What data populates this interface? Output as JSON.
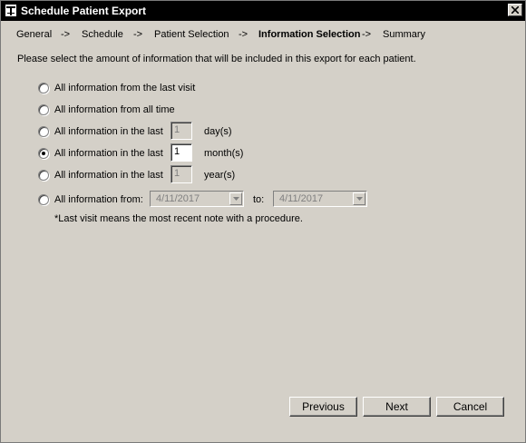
{
  "window": {
    "title": "Schedule Patient Export"
  },
  "breadcrumb": {
    "steps": [
      "General",
      "Schedule",
      "Patient Selection",
      "Information Selection",
      "Summary"
    ],
    "separator": "->",
    "active_index": 3
  },
  "instruction": "Please select the amount of information that will be included in this export for each patient.",
  "options": {
    "last_visit": {
      "label": "All information from the last visit",
      "selected": false
    },
    "all_time": {
      "label": "All information from all time",
      "selected": false
    },
    "last_days": {
      "label": "All information in the last",
      "value": "1",
      "unit": "day(s)",
      "selected": false
    },
    "last_months": {
      "label": "All information in the last",
      "value": "1",
      "unit": "month(s)",
      "selected": true
    },
    "last_years": {
      "label": "All information in the last",
      "value": "1",
      "unit": "year(s)",
      "selected": false
    },
    "date_range": {
      "label": "All information from:",
      "from": "4/11/2017",
      "to_label": "to:",
      "to": "4/11/2017",
      "selected": false
    }
  },
  "note": "*Last visit means the most recent note with a procedure.",
  "buttons": {
    "previous": "Previous",
    "next": "Next",
    "cancel": "Cancel"
  }
}
